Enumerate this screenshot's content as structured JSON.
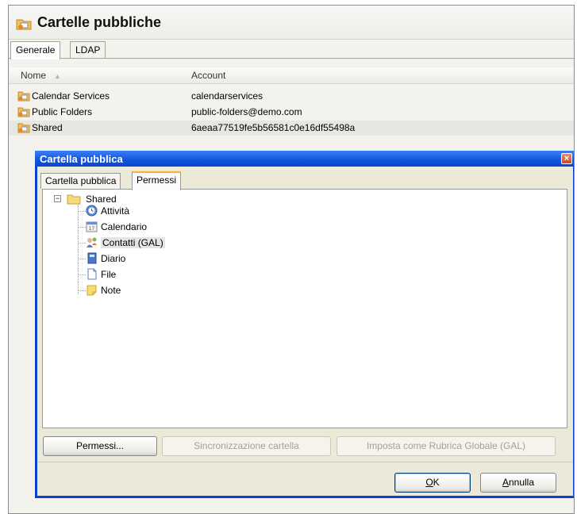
{
  "window": {
    "title": "Cartelle pubbliche",
    "tabs": [
      "Generale",
      "LDAP"
    ]
  },
  "list": {
    "columns": {
      "name": "Nome",
      "account": "Account"
    },
    "rows": [
      {
        "name": "Calendar Services",
        "account": "calendarservices"
      },
      {
        "name": "Public Folders",
        "account": "public-folders@demo.com"
      },
      {
        "name": "Shared",
        "account": "6aeaa77519fe5b56581c0e16df55498a"
      }
    ]
  },
  "dialog": {
    "title": "Cartella pubblica",
    "close": "×",
    "tabs": [
      "Cartella pubblica",
      "Permessi"
    ],
    "tree": {
      "root": "Shared",
      "expander": "−",
      "children": [
        "Attività",
        "Calendario",
        "Contatti (GAL)",
        "Diario",
        "File",
        "Note"
      ]
    },
    "buttons": {
      "permissions": "Permessi...",
      "sync": "Sincronizzazione cartella",
      "gal": "Imposta come Rubrica Globale (GAL)",
      "ok_key": "O",
      "ok_rest": "K",
      "cancel_key": "A",
      "cancel_rest": "nnulla"
    }
  },
  "colors": {
    "titlebar": "#0a46d0",
    "dialog_bg": "#ece9d8",
    "selected_row": "#e7e7e1"
  }
}
